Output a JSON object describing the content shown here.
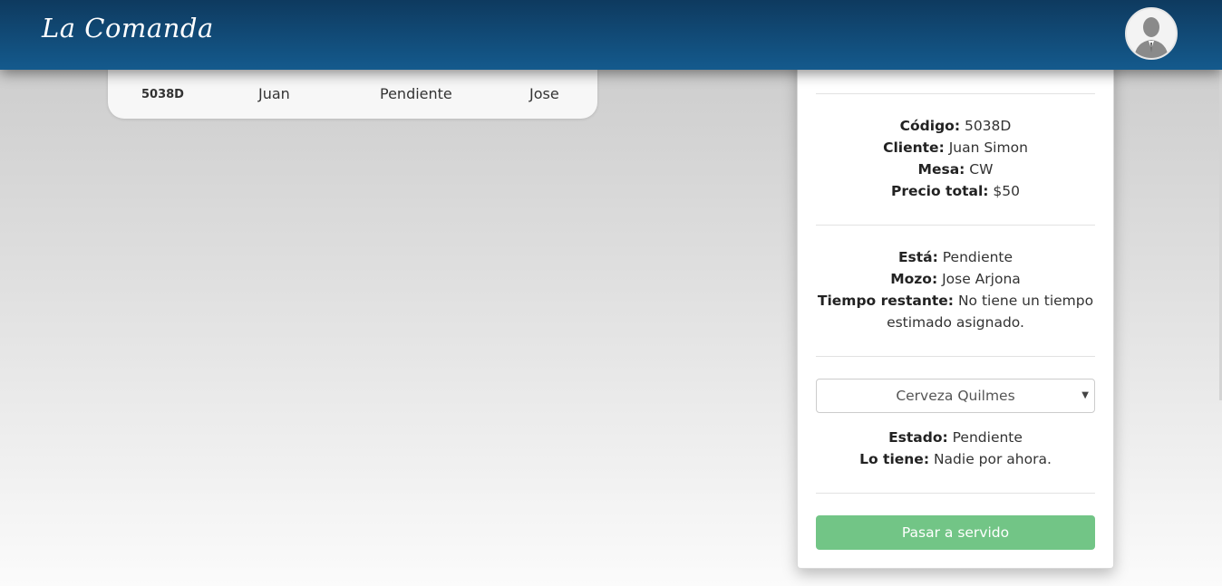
{
  "navbar": {
    "brand": "La Comanda",
    "avatar_icon": "user-avatar-icon"
  },
  "orders_list": {
    "rows": [
      {
        "code": "5038D",
        "client": "Juan",
        "state": "Pendiente",
        "waiter": "Jose"
      }
    ]
  },
  "order_detail": {
    "code_label": "Código:",
    "code_value": "5038D",
    "client_label": "Cliente:",
    "client_value": "Juan Simon",
    "table_label": "Mesa:",
    "table_value": "CW",
    "price_label": "Precio total:",
    "price_value": "$50",
    "status_label": "Está:",
    "status_value": "Pendiente",
    "waiter_label": "Mozo:",
    "waiter_value": "Jose Arjona",
    "time_label": "Tiempo restante:",
    "time_value": "No tiene un tiempo estimado asignado.",
    "product_select": {
      "selected": "Cerveza Quilmes"
    },
    "item_state_label": "Estado:",
    "item_state_value": "Pendiente",
    "holder_label": "Lo tiene:",
    "holder_value": "Nadie por ahora.",
    "serve_button": "Pasar a servido"
  },
  "colors": {
    "navbar": "#145a8d",
    "button": "#72c586"
  }
}
